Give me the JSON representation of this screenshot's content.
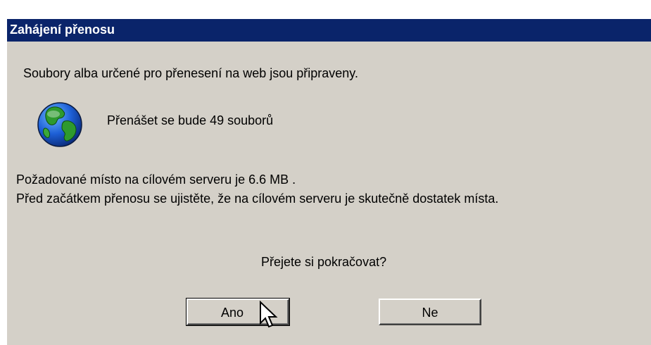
{
  "dialog": {
    "title": "Zahájení přenosu",
    "intro": "Soubory alba určené pro přenesení na web jsou připraveny.",
    "file_count_text": "Přenášet se bude 49 souborů",
    "space_required_text": "Požadované místo na cílovém serveru je 6.6 MB .",
    "warning_text": "Před začátkem přenosu se ujistěte, že na cílovém serveru je skutečně dostatek místa.",
    "question": "Přejete si pokračovat?",
    "yes_label": "Ano",
    "no_label": "Ne"
  },
  "icons": {
    "globe": "globe-icon",
    "cursor": "mouse-pointer-icon"
  },
  "colors": {
    "titlebar": "#0a246a",
    "dialog_bg": "#d4d0c8",
    "title_text": "#ffffff"
  }
}
